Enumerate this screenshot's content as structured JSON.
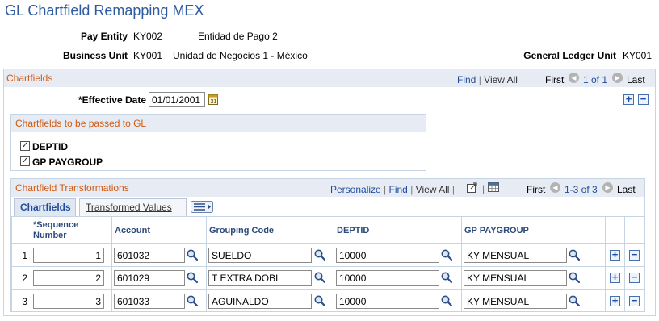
{
  "page": {
    "title": "GL Chartfield Remapping MEX"
  },
  "header": {
    "pay_entity_label": "Pay Entity",
    "pay_entity_code": "KY002",
    "pay_entity_desc": "Entidad de Pago 2",
    "business_unit_label": "Business Unit",
    "business_unit_code": "KY001",
    "business_unit_desc": "Unidad de Negocios 1 - México",
    "gl_unit_label": "General Ledger Unit",
    "gl_unit_code": "KY001"
  },
  "chartfields": {
    "title": "Chartfields",
    "find": "Find",
    "sep": "|",
    "view_all": "View All",
    "first": "First",
    "range": "1 of 1",
    "last": "Last",
    "effective_date_label": "*Effective Date",
    "effective_date": "01/01/2001",
    "passed": {
      "title": "Chartfields to be passed to GL",
      "items": [
        {
          "label": "DEPTID",
          "checked": true
        },
        {
          "label": "GP PAYGROUP",
          "checked": true
        }
      ]
    }
  },
  "transformations": {
    "title": "Chartfield Transformations",
    "personalize": "Personalize",
    "find": "Find",
    "view_all": "View All",
    "sep": "|",
    "first": "First",
    "range": "1-3 of 3",
    "last": "Last",
    "tabs": [
      {
        "label": "Chartfields",
        "active": true
      },
      {
        "label": "Transformed Values",
        "active": false
      }
    ],
    "columns": {
      "seq_line1": "*Sequence",
      "seq_line2": "Number",
      "account": "Account",
      "grouping": "Grouping Code",
      "deptid": "DEPTID",
      "paygroup": "GP PAYGROUP"
    },
    "rows": [
      {
        "num": "1",
        "seq": "1",
        "account": "601032",
        "grouping": "SUELDO",
        "deptid": "10000",
        "paygroup": "KY MENSUAL"
      },
      {
        "num": "2",
        "seq": "2",
        "account": "601029",
        "grouping": "T EXTRA DOBL",
        "deptid": "10000",
        "paygroup": "KY MENSUAL"
      },
      {
        "num": "3",
        "seq": "3",
        "account": "601033",
        "grouping": "AGUINALDO",
        "deptid": "10000",
        "paygroup": "KY MENSUAL"
      }
    ]
  },
  "icons": {
    "add": "+",
    "remove": "−",
    "first_arrow": "◀",
    "next_arrow": "▶"
  },
  "colors": {
    "accent": "#d05a14",
    "link": "#1f4c9c",
    "title": "#2d5aa0",
    "border": "#c7d4e4"
  }
}
